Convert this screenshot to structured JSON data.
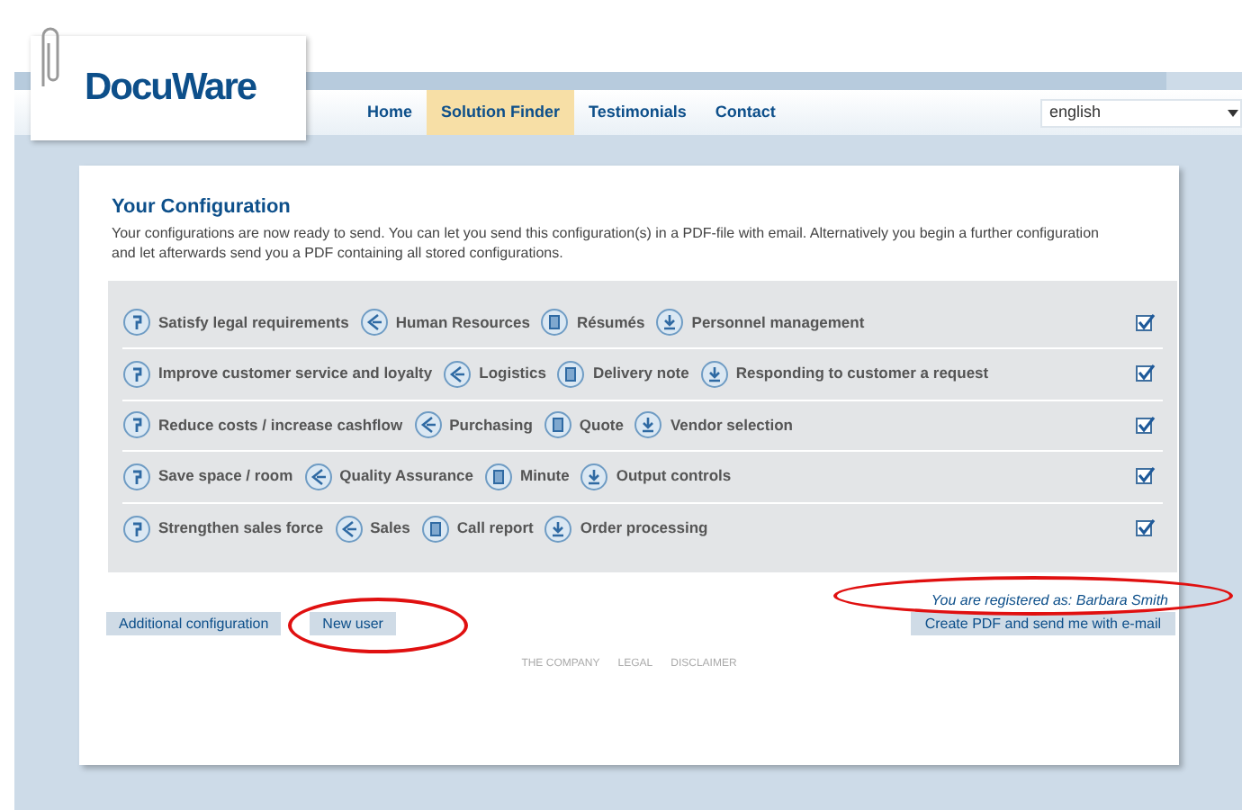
{
  "logo": {
    "text": "DocuWare"
  },
  "nav": [
    {
      "label": "Home",
      "selected": false
    },
    {
      "label": "Solution Finder",
      "selected": true
    },
    {
      "label": "Testimonials",
      "selected": false
    },
    {
      "label": "Contact",
      "selected": false
    }
  ],
  "language_select": {
    "value": "english"
  },
  "configuration": {
    "title": "Your Configuration",
    "text": "Your configurations are now ready to send. You can let you send this configuration(s) in a PDF-file with email. Alternatively you begin a further configuration and let afterwards send you a PDF containing all stored configurations.",
    "rows": [
      {
        "checked": true,
        "items": [
          {
            "kind": "goal",
            "label": "Satisfy legal requirements"
          },
          {
            "kind": "department",
            "label": "Human Resources"
          },
          {
            "kind": "document",
            "label": "Résumés"
          },
          {
            "kind": "process",
            "label": "Personnel management"
          }
        ]
      },
      {
        "checked": true,
        "items": [
          {
            "kind": "goal",
            "label": "Improve customer service and loyalty"
          },
          {
            "kind": "department",
            "label": "Logistics"
          },
          {
            "kind": "document",
            "label": "Delivery note"
          },
          {
            "kind": "process",
            "label": "Responding to customer a request"
          }
        ]
      },
      {
        "checked": true,
        "items": [
          {
            "kind": "goal",
            "label": "Reduce costs / increase cashflow"
          },
          {
            "kind": "department",
            "label": "Purchasing"
          },
          {
            "kind": "document",
            "label": "Quote"
          },
          {
            "kind": "process",
            "label": "Vendor selection"
          }
        ]
      },
      {
        "checked": true,
        "items": [
          {
            "kind": "goal",
            "label": "Save space / room"
          },
          {
            "kind": "department",
            "label": "Quality Assurance"
          },
          {
            "kind": "document",
            "label": "Minute"
          },
          {
            "kind": "process",
            "label": "Output controls"
          }
        ]
      },
      {
        "checked": true,
        "items": [
          {
            "kind": "goal",
            "label": "Strengthen sales force"
          },
          {
            "kind": "department",
            "label": "Sales"
          },
          {
            "kind": "document",
            "label": "Call report"
          },
          {
            "kind": "process",
            "label": "Order processing"
          }
        ]
      }
    ]
  },
  "buttons_left": [
    "Additional configuration",
    "New user"
  ],
  "registered_text": "You are registered as: Barbara Smith",
  "pdf_button": "Create PDF and send me with e-mail",
  "footer_links": [
    "THE COMPANY",
    "LEGAL",
    "DISCLAIMER"
  ]
}
